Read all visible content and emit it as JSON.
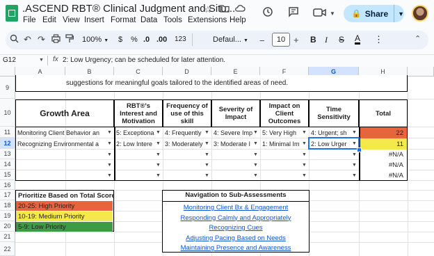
{
  "app": {
    "title": ".ASCEND RBT® Clinical Judgment and Situ...",
    "menu": [
      "File",
      "Edit",
      "View",
      "Insert",
      "Format",
      "Data",
      "Tools",
      "Extensions",
      "Help"
    ],
    "share_label": "Share"
  },
  "toolbar": {
    "zoom": "100%",
    "currency": "$",
    "percent": "%",
    "decrease_decimal": ".0",
    "increase_decimal": ".00",
    "number_format": "123",
    "font": "Defaul...",
    "font_size": "10",
    "bold": "B",
    "italic": "I",
    "text_color": "A"
  },
  "formula_bar": {
    "cell_ref": "G12",
    "fx": "fx",
    "content": "2: Low Urgency; can be scheduled for later attention."
  },
  "columns": [
    "A",
    "B",
    "C",
    "D",
    "E",
    "F",
    "G",
    "H"
  ],
  "rows": [
    "9",
    "10",
    "11",
    "12",
    "13",
    "14",
    "15",
    "16",
    "17",
    "18",
    "19",
    "20",
    "21",
    "22"
  ],
  "top_text": "suggestions for meaningful goals tailored to the identified areas of need.",
  "table": {
    "headers": [
      "Growth Area",
      "RBT®'s Interest and Motivation",
      "Frequency of use of this skill",
      "Severity of Impact",
      "Impact on Client Outcomes",
      "Time Sensitivity",
      "Total"
    ],
    "rows": [
      [
        "Monitoring Client Behavior an",
        "5: Exceptiona",
        "4: Frequently",
        "4: Severe Imp",
        "5: Very High",
        "4: Urgent; sh",
        "22"
      ],
      [
        "Recognizing Environmental a",
        "2: Low Intere",
        "3: Moderately",
        "3: Moderate I",
        "1: Minimal Im",
        "2: Low Urger",
        "11"
      ],
      [
        "",
        "",
        "",
        "",
        "",
        "",
        "#N/A"
      ],
      [
        "",
        "",
        "",
        "",
        "",
        "",
        "#N/A"
      ],
      [
        "",
        "",
        "",
        "",
        "",
        "",
        "#N/A"
      ]
    ],
    "total_colors": [
      "#e8643c",
      "#f5e84a",
      "#ffffff",
      "#ffffff",
      "#ffffff"
    ]
  },
  "priority": {
    "title": "Prioritize Based on Total Score",
    "items": [
      {
        "label": "20-25: High Priority",
        "color": "#e8643c"
      },
      {
        "label": "10-19: Medium Priority",
        "color": "#f5e84a"
      },
      {
        "label": "5-9: Low Priority",
        "color": "#3f9a45"
      }
    ]
  },
  "navigation": {
    "title": "Navigation to Sub-Assessments",
    "links": [
      "Monitoring Client Bx & Engagement",
      "Responding Calmly and Appropriately",
      "Recognizing Cues",
      "Adjusting Pacing Based on Needs",
      "Maintaining Presence and Awareness"
    ]
  }
}
